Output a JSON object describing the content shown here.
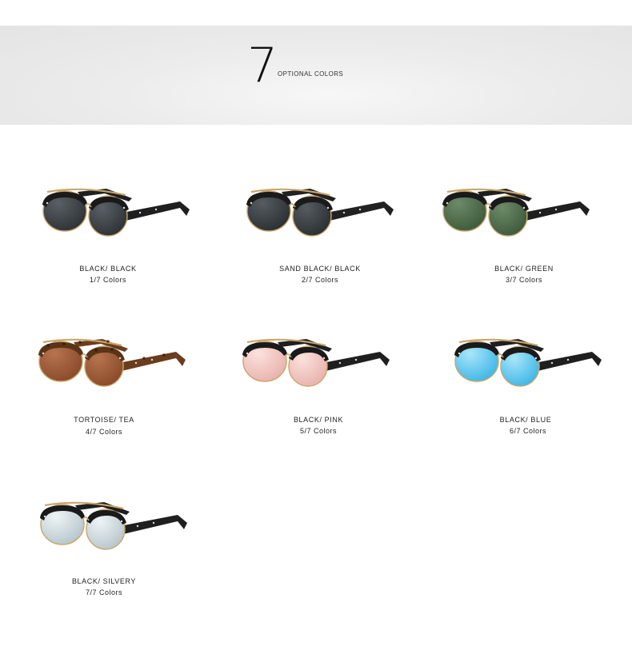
{
  "header": {
    "count": "7",
    "label": "OPTIONAL COLORS"
  },
  "colors": [
    {
      "name": "BLACK/ BLACK",
      "count": "1/7 Colors",
      "frame": "#1a1a1a",
      "temple": "#1f1f1f",
      "lens": "#2e3236",
      "lens_hi": "#5a6066"
    },
    {
      "name": "SAND BLACK/ BLACK",
      "count": "2/7 Colors",
      "frame": "#1b1b1b",
      "temple": "#222222",
      "lens": "#2b2f33",
      "lens_hi": "#565c61"
    },
    {
      "name": "BLACK/ GREEN",
      "count": "3/7 Colors",
      "frame": "#1a1a1a",
      "temple": "#1f1f1f",
      "lens": "#3d5a3a",
      "lens_hi": "#6d8a69"
    },
    {
      "name": "TORTOISE/ TEA",
      "count": "4/7 Colors",
      "frame": "#5a3418",
      "temple": "#6b3d1c",
      "lens": "#8a4a2a",
      "lens_hi": "#b6744e"
    },
    {
      "name": "BLACK/ PINK",
      "count": "5/7 Colors",
      "frame": "#1a1a1a",
      "temple": "#1f1f1f",
      "lens": "#e8b2ad",
      "lens_hi": "#fbe2dd"
    },
    {
      "name": "BLACK/ BLUE",
      "count": "6/7 Colors",
      "frame": "#1a1a1a",
      "temple": "#1f1f1f",
      "lens": "#3fb6e6",
      "lens_hi": "#a9e6fa"
    },
    {
      "name": "BLACK/ SILVERY",
      "count": "7/7 Colors",
      "frame": "#1a1a1a",
      "temple": "#1f1f1f",
      "lens": "#b7c6cc",
      "lens_hi": "#eef4f6"
    }
  ]
}
